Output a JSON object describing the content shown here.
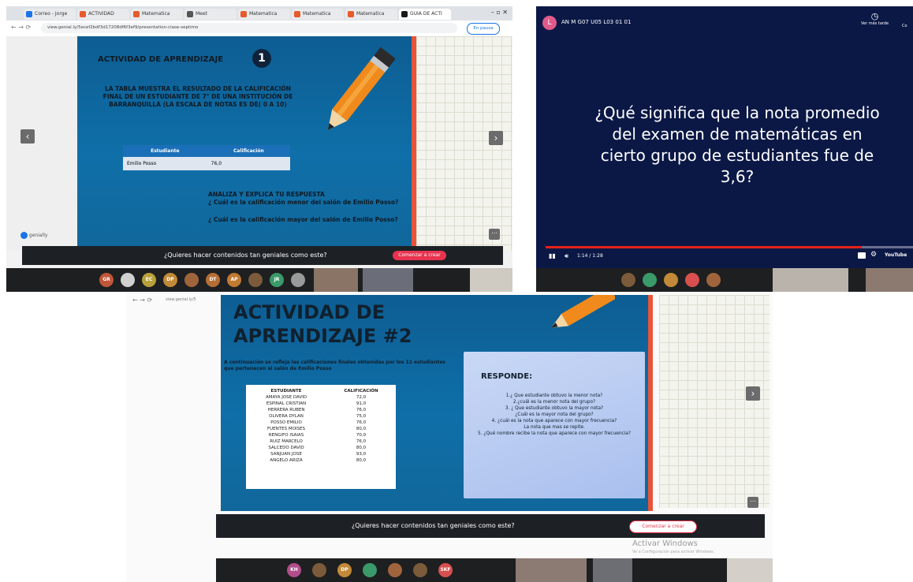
{
  "top_left": {
    "tabs": [
      {
        "label": "Correo - Jorge",
        "color": "#1a73e8"
      },
      {
        "label": "ACTIVIDAD",
        "color": "#e65a2b"
      },
      {
        "label": "Matematica",
        "color": "#e65a2b"
      },
      {
        "label": "Meet",
        "color": "#555555"
      },
      {
        "label": "Matematica",
        "color": "#e65a2b"
      },
      {
        "label": "Matematica",
        "color": "#e65a2b"
      },
      {
        "label": "Matematica",
        "color": "#e65a2b"
      },
      {
        "label": "GUIA DE ACTI",
        "color": "#1a1a1a"
      }
    ],
    "address": "view.genial.ly/5ecef2bdf3d17208df6f3ef9/presentation-clase-septimo",
    "badge": "En pausa",
    "slide": {
      "title": "ACTIVIDAD DE APRENDIZAJE",
      "number": "1",
      "body": "LA TABLA MUESTRA EL RESULTADO DE LA CALIFICACIÓN FINAL DE UN ESTUDIANTE DE 7° DE UNA INSTITUCIÓN DE BARRANQUILLA (LA ESCALA DE NOTAS ES DE( 0 A 10)",
      "table_headers": [
        "Estudiante",
        "Calificación"
      ],
      "table_row": [
        "Emilio Posso",
        "76,0"
      ],
      "prompt_title": "ANALIZA Y EXPLICA TU RESPUESTA",
      "question_1": "¿ Cuál es la calificación menor del salón de Emilio Posso?",
      "question_2": "¿ Cuál es la calificación mayor del salón de Emilio Posso?",
      "logo": "genially"
    },
    "promo_text": "¿Quieres hacer contenidos tan geniales como este?",
    "promo_button": "Comenzar a crear",
    "avatars": [
      {
        "label": "GR",
        "color": "#c0563a"
      },
      {
        "label": "",
        "color": "#d0d0d0"
      },
      {
        "label": "EC",
        "color": "#b9a13a"
      },
      {
        "label": "DP",
        "color": "#c28a38"
      },
      {
        "label": "",
        "color": "#a0643c"
      },
      {
        "label": "DT",
        "color": "#b56e35"
      },
      {
        "label": "AP",
        "color": "#c07a32"
      },
      {
        "label": "",
        "color": "#7b5b3a"
      },
      {
        "label": "JR",
        "color": "#3a9a6a"
      },
      {
        "label": "",
        "color": "#9a9a9a"
      }
    ]
  },
  "top_right": {
    "channel_initial": "L",
    "video_title": "AN M G07 U05 L03 01 01",
    "watch_later": "Ver más tarde",
    "share_short": "Co",
    "question": "¿Qué significa que la nota promedio del examen de matemáticas en cierto grupo de estudiantes fue de 3,6?",
    "time": "1:14 / 1:28",
    "progress": 0.86,
    "brand": "YouTube",
    "avatars": [
      {
        "label": "",
        "color": "#7b5b3a"
      },
      {
        "label": "",
        "color": "#3a9a6a"
      },
      {
        "label": "",
        "color": "#c28a38"
      },
      {
        "label": "",
        "color": "#d84f4f"
      },
      {
        "label": "",
        "color": "#a0643c"
      }
    ]
  },
  "bottom": {
    "address": "view.genial.ly/5",
    "slide": {
      "title_line1": "ACTIVIDAD DE",
      "title_line2": "APRENDIZAJE #2",
      "intro": "A continuación se refleja las calificaciones finales obtenidas por los 11 estudiantes que pertenecen al salón de Emilio Posso",
      "table_headers": [
        "ESTUDIANTE",
        "CALIFICACIÓN"
      ],
      "rows": [
        [
          "AMAYA JOSE DAVID",
          "72,0"
        ],
        [
          "ESPINAL CRISTIAN",
          "91,0"
        ],
        [
          "HERRERA RUBEN",
          "76,0"
        ],
        [
          "OLIVERA DYLAN",
          "75,0"
        ],
        [
          "POSSO EMILIO",
          "76,0"
        ],
        [
          "FUENTES MOISES",
          "80,0"
        ],
        [
          "RENGIFO ISAIAS",
          "70,0"
        ],
        [
          "RUIZ MARCELO",
          "76,0"
        ],
        [
          "SALCEDO DAVID",
          "80,0"
        ],
        [
          "SANJUAN JOSE",
          "93,0"
        ],
        [
          "ANGELO ARIZA",
          "80,0"
        ]
      ],
      "responde_title": "RESPONDE:",
      "responde_items": [
        "1.¿ Que estudiante obtuvo la menor nota?",
        "2.¿cuál es la menor nota del grupo?",
        "3. ¿ Que estudiante obtuvo la mayor nota?",
        "¿Cuál es la mayor nota del grupo?",
        "4. ¿cuál es la nota que aparece con mayor frecuencia?",
        "La nota que mas se repite.",
        "5. ¿Qué nombre recibe la nota que aparece con mayor frecuencia?"
      ]
    },
    "promo_text": "¿Quieres hacer contenidos tan geniales como este?",
    "promo_button": "Comenzar a crear",
    "windows_line1": "Activar Windows",
    "windows_line2": "Ve a Configuración para activar Windows.",
    "avatars": [
      {
        "label": "KH",
        "color": "#b04d8a"
      },
      {
        "label": "",
        "color": "#7b5b3a"
      },
      {
        "label": "DP",
        "color": "#c28a38"
      },
      {
        "label": "",
        "color": "#3a9a6a"
      },
      {
        "label": "",
        "color": "#a0643c"
      },
      {
        "label": "",
        "color": "#7b5b3a"
      },
      {
        "label": "SKF",
        "color": "#d84f4f"
      }
    ]
  }
}
